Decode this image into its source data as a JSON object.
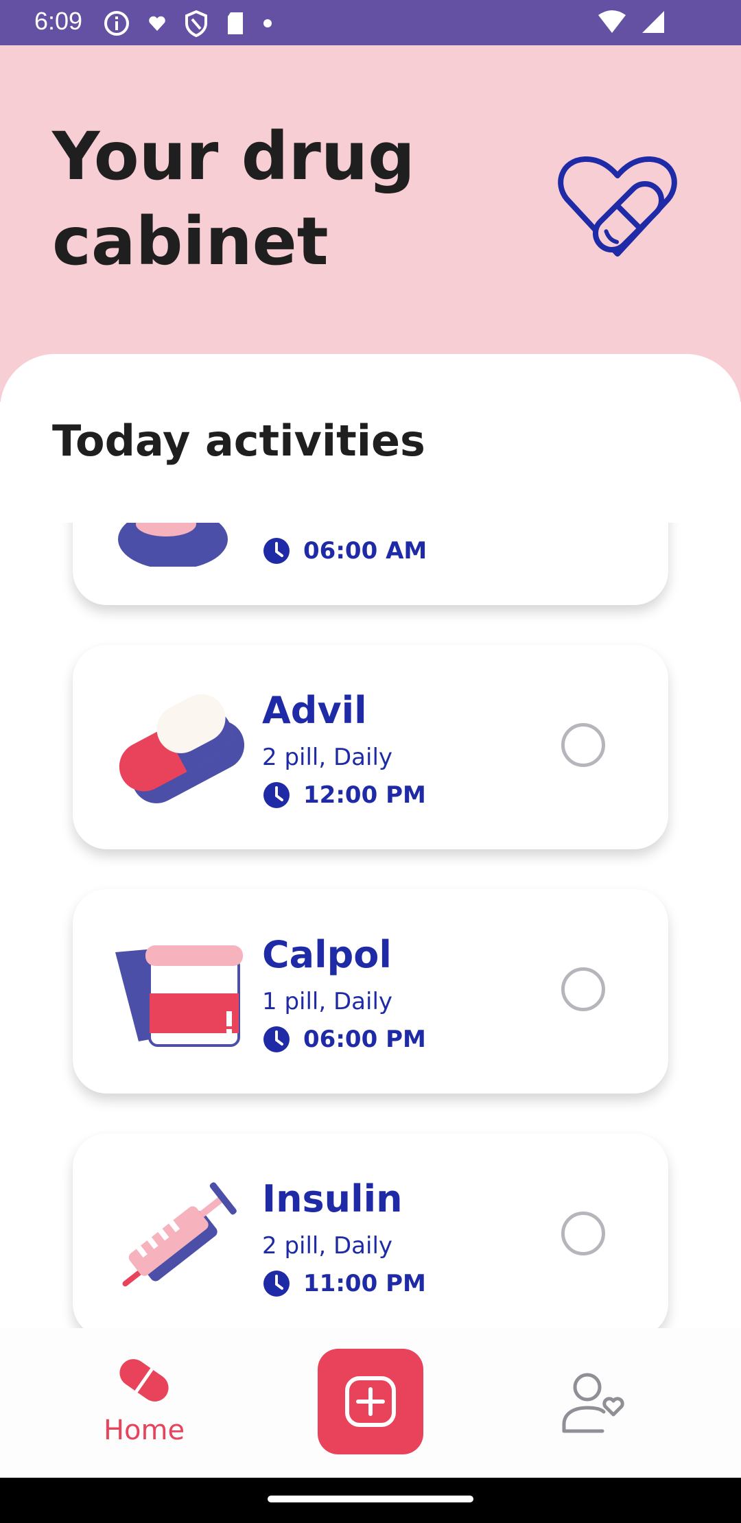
{
  "status_bar": {
    "time": "6:09",
    "icons": [
      "info-icon",
      "heart-icon",
      "shield-icon",
      "sd-card-icon",
      "dot-icon",
      "wifi-icon",
      "signal-icon"
    ]
  },
  "header": {
    "title_line1": "Your drug",
    "title_line2": "cabinet",
    "icon": "heart-pill-icon"
  },
  "section_title": "Today activities",
  "medications": [
    {
      "name": "",
      "dose": "",
      "time": "06:00 AM"
    },
    {
      "name": "Advil",
      "dose": "2 pill, Daily",
      "time": "12:00 PM"
    },
    {
      "name": "Calpol",
      "dose": "1 pill, Daily",
      "time": "06:00 PM"
    },
    {
      "name": "Insulin",
      "dose": "2 pill, Daily",
      "time": "11:00 PM"
    }
  ],
  "bottom_nav": {
    "home_label": "Home",
    "add_icon": "add-square-icon",
    "profile_icon": "user-heart-icon"
  },
  "colors": {
    "status_bar": "#6551a3",
    "header_bg": "#f8ced5",
    "accent": "#e8435b",
    "text_blue": "#1e2aa6"
  }
}
